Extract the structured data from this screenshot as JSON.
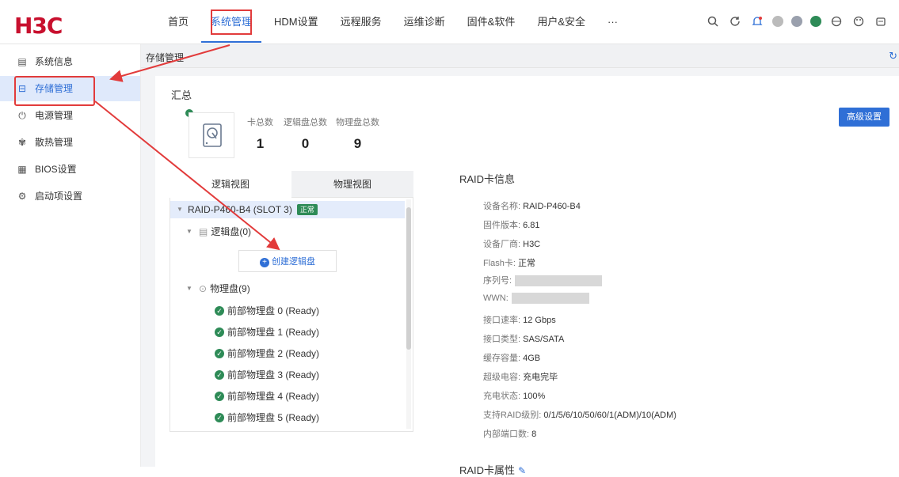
{
  "brand": {
    "logo": "H3C"
  },
  "nav": [
    {
      "label": "首页"
    },
    {
      "label": "系统管理"
    },
    {
      "label": "HDM设置"
    },
    {
      "label": "远程服务"
    },
    {
      "label": "运维诊断"
    },
    {
      "label": "固件&软件"
    },
    {
      "label": "用户&安全"
    },
    {
      "label": "···"
    }
  ],
  "sidebar": [
    {
      "label": "系统信息",
      "icon": "document-icon"
    },
    {
      "label": "存储管理",
      "icon": "storage-icon"
    },
    {
      "label": "电源管理",
      "icon": "power-icon"
    },
    {
      "label": "散热管理",
      "icon": "fan-icon"
    },
    {
      "label": "BIOS设置",
      "icon": "bios-icon"
    },
    {
      "label": "启动项设置",
      "icon": "gear-icon"
    }
  ],
  "breadcrumb": "存储管理",
  "summary": {
    "title": "汇总",
    "stats": [
      {
        "label": "卡总数",
        "value": "1"
      },
      {
        "label": "逻辑盘总数",
        "value": "0"
      },
      {
        "label": "物理盘总数",
        "value": "9"
      }
    ],
    "advanced_button": "高级设置"
  },
  "tabs": {
    "logical": "逻辑视图",
    "physical": "物理视图"
  },
  "tree": {
    "controller": "RAID-P460-B4 (SLOT 3)",
    "controller_status": "正常",
    "logical_group": "逻辑盘(0)",
    "create_button": "创建逻辑盘",
    "physical_group": "物理盘(9)",
    "disks": [
      "前部物理盘 0 (Ready)",
      "前部物理盘 1 (Ready)",
      "前部物理盘 2 (Ready)",
      "前部物理盘 3 (Ready)",
      "前部物理盘 4 (Ready)",
      "前部物理盘 5 (Ready)"
    ]
  },
  "raid_info": {
    "title": "RAID卡信息",
    "items": [
      {
        "label": "设备名称:",
        "value": "RAID-P460-B4"
      },
      {
        "label": "固件版本:",
        "value": "6.81"
      },
      {
        "label": "设备厂商:",
        "value": "H3C"
      },
      {
        "label": "Flash卡:",
        "value": "正常"
      },
      {
        "label": "序列号:",
        "value": ""
      },
      {
        "label": "WWN:",
        "value": ""
      },
      {
        "label": "接口速率:",
        "value": "12 Gbps"
      },
      {
        "label": "接口类型:",
        "value": "SAS/SATA"
      },
      {
        "label": "缓存容量:",
        "value": "4GB"
      },
      {
        "label": "超级电容:",
        "value": "充电完毕"
      },
      {
        "label": "充电状态:",
        "value": "100%"
      },
      {
        "label": "支持RAID级别:",
        "value": "0/1/5/6/10/50/60/1(ADM)/10(ADM)"
      },
      {
        "label": "内部端口数:",
        "value": "8"
      }
    ],
    "properties_title": "RAID卡属性"
  },
  "colors": {
    "accent": "#2f6fd6",
    "brand": "#c8102e",
    "ok": "#2e8b57",
    "annotation": "#e23b3b"
  }
}
